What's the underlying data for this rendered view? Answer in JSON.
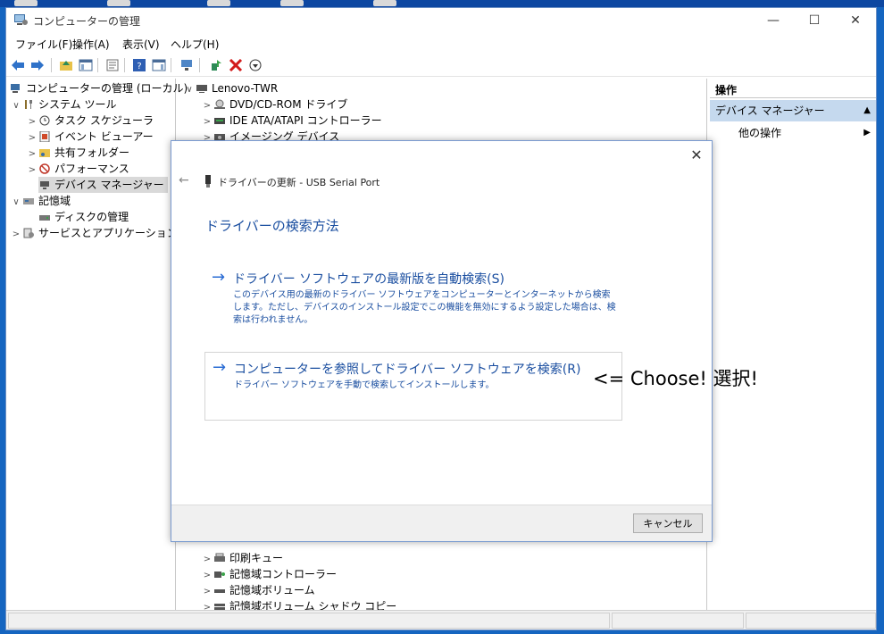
{
  "window": {
    "title": "コンピューターの管理"
  },
  "menu": [
    "ファイル(F)",
    "操作(A)",
    "表示(V)",
    "ヘルプ(H)"
  ],
  "tree_left": [
    {
      "label": "コンピューターの管理 (ローカル)"
    },
    {
      "label": "システム ツール"
    },
    {
      "label": "タスク スケジューラ"
    },
    {
      "label": "イベント ビューアー"
    },
    {
      "label": "共有フォルダー"
    },
    {
      "label": "パフォーマンス"
    },
    {
      "label": "デバイス マネージャー"
    },
    {
      "label": "記憶域"
    },
    {
      "label": "ディスクの管理"
    },
    {
      "label": "サービスとアプリケーション"
    }
  ],
  "tree_center": {
    "root": "Lenovo-TWR",
    "top_items": [
      "DVD/CD-ROM ドライブ",
      "IDE ATA/ATAPI コントローラー",
      "イメージング デバイス"
    ],
    "bottom_items": [
      "印刷キュー",
      "記憶域コントローラー",
      "記憶域ボリューム",
      "記憶域ボリューム シャドウ コピー"
    ]
  },
  "actions": {
    "header": "操作",
    "selected": "デバイス マネージャー",
    "more": "他の操作"
  },
  "dialog": {
    "title": "ドライバーの更新 - USB Serial Port",
    "heading": "ドライバーの検索方法",
    "option1": {
      "title": "ドライバー ソフトウェアの最新版を自動検索(S)",
      "desc": "このデバイス用の最新のドライバー ソフトウェアをコンピューターとインターネットから検索します。ただし、デバイスのインストール設定でこの機能を無効にするよう設定した場合は、検索は行われません。"
    },
    "option2": {
      "title": "コンピューターを参照してドライバー ソフトウェアを検索(R)",
      "desc": "ドライバー ソフトウェアを手動で検索してインストールします。"
    },
    "cancel": "キャンセル"
  },
  "annotation": "<= Choose! 選択!",
  "icons": {
    "back": "back-arrow-icon",
    "forward": "forward-arrow-icon",
    "close": "close-icon",
    "option_arrow": "right-arrow-icon",
    "device": "usb-device-icon"
  },
  "colors": {
    "link": "#1a4ea0",
    "arrow": "#2a6cd4",
    "desktop": "#1565c0",
    "selection": "#c5d9ee"
  }
}
